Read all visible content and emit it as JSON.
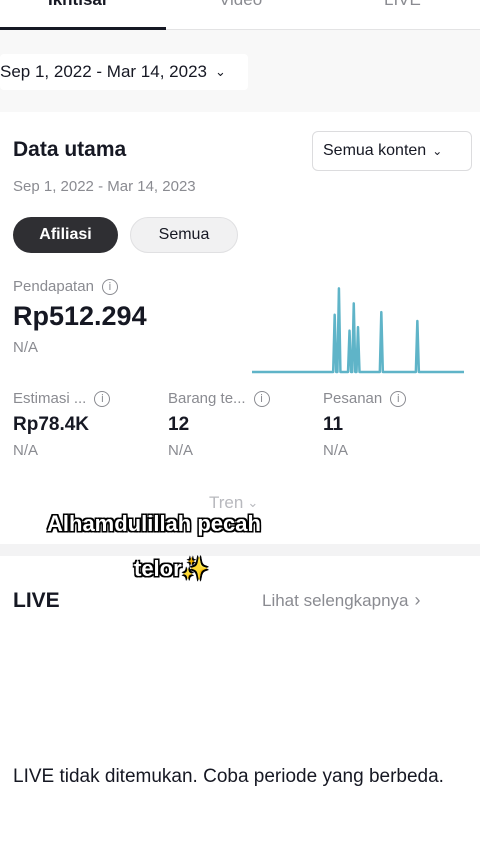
{
  "tabs": [
    {
      "label": "Ikhtisar",
      "active": true
    },
    {
      "label": "Video",
      "active": false
    },
    {
      "label": "LIVE",
      "active": false
    }
  ],
  "date_filter": "Sep 1, 2022 - Mar 14, 2023",
  "main_data": {
    "title": "Data utama",
    "content_filter": "Semua konten",
    "date_range": "Sep 1, 2022 - Mar 14, 2023",
    "pills": [
      "Afiliasi",
      "Semua"
    ],
    "revenue": {
      "label": "Pendapatan",
      "value": "Rp512.294",
      "change": "N/A"
    },
    "metrics": [
      {
        "label": "Estimasi ...",
        "value": "Rp78.4K",
        "change": "N/A"
      },
      {
        "label": "Barang te...",
        "value": "12",
        "change": "N/A"
      },
      {
        "label": "Pesanan",
        "value": "11",
        "change": "N/A"
      }
    ],
    "trend_label": "Tren",
    "sparkline": {
      "color": "#5fb4c8",
      "spikes": [
        {
          "position": 0.39,
          "height": 0.65
        },
        {
          "position": 0.41,
          "height": 0.95
        },
        {
          "position": 0.46,
          "height": 0.47
        },
        {
          "position": 0.48,
          "height": 0.78
        },
        {
          "position": 0.5,
          "height": 0.51
        },
        {
          "position": 0.61,
          "height": 0.68
        },
        {
          "position": 0.78,
          "height": 0.58
        }
      ]
    }
  },
  "live_section": {
    "title": "LIVE",
    "see_more": "Lihat selengkapnya",
    "empty_message": "LIVE tidak ditemukan. Coba periode yang berbeda."
  },
  "caption": {
    "line1": "Alhamdulillah pecah",
    "line2": "telor✨"
  },
  "icons": {
    "chevron": "chevron-down-icon",
    "info": "info-icon",
    "arrow": "chevron-right-icon"
  }
}
